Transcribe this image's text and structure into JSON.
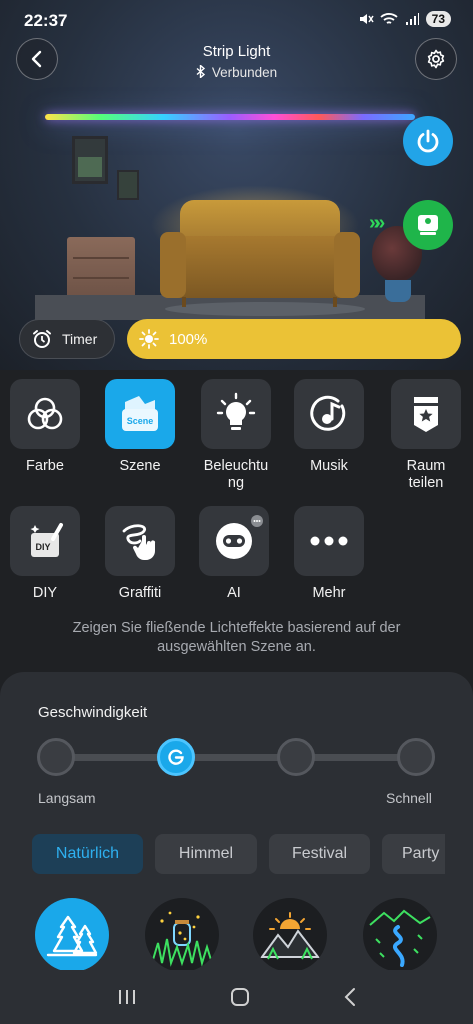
{
  "status_bar": {
    "time": "22:37",
    "battery": "73"
  },
  "header": {
    "title": "Strip Light",
    "connection_status": "Verbunden"
  },
  "controls": {
    "timer_label": "Timer",
    "brightness_label": "100%",
    "brightness_level": 1.0
  },
  "modes": [
    {
      "label": "Farbe",
      "icon": "color-rings-icon",
      "active": false
    },
    {
      "label": "Szene",
      "icon": "scene-icon",
      "active": true,
      "badge": "Scene"
    },
    {
      "label": "Beleuchtu\nng",
      "icon": "lightbulb-icon",
      "active": false
    },
    {
      "label": "Musik",
      "icon": "music-icon",
      "active": false
    },
    {
      "label": "Raum\nteilen",
      "icon": "room-split-icon",
      "active": false
    },
    {
      "label": "DIY",
      "icon": "diy-icon",
      "active": false,
      "badge": "DIY"
    },
    {
      "label": "Graffiti",
      "icon": "graffiti-icon",
      "active": false
    },
    {
      "label": "AI",
      "icon": "ai-icon",
      "active": false
    },
    {
      "label": "Mehr",
      "icon": "more-icon",
      "active": false
    }
  ],
  "mode_description": "Zeigen Sie fließende Lichteffekte basierend auf der ausgewählten Szene an.",
  "speed": {
    "title": "Geschwindigkeit",
    "min_label": "Langsam",
    "max_label": "Schnell",
    "steps": 4,
    "selected_step": 1
  },
  "scene_categories": [
    {
      "label": "Natürlich",
      "active": true
    },
    {
      "label": "Himmel",
      "active": false
    },
    {
      "label": "Festival",
      "active": false
    },
    {
      "label": "Party",
      "active": false
    }
  ],
  "scenes": [
    {
      "icon": "forest-icon",
      "active": true
    },
    {
      "icon": "firefly-jar-icon",
      "active": false
    },
    {
      "icon": "sunrise-mountain-icon",
      "active": false
    },
    {
      "icon": "river-valley-icon",
      "active": false
    }
  ],
  "colors": {
    "accent": "#1aa8ea",
    "brightness": "#ebc236",
    "power": "#22a4e8",
    "device": "#1fb54a",
    "background": "#1f2124"
  }
}
